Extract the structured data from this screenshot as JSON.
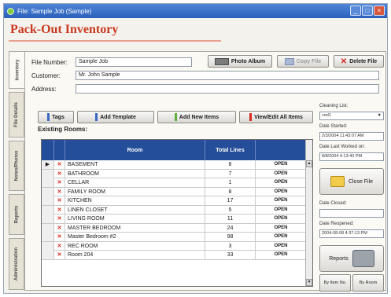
{
  "window": {
    "title": "File: Sample Job (Sample)",
    "minimize": "_",
    "maximize": "□",
    "close": "×"
  },
  "app": {
    "title": "Pack-Out Inventory"
  },
  "tabs": [
    "Inventory",
    "File Details",
    "Notes/Photos",
    "Reports",
    "Administration"
  ],
  "form": {
    "file_number_label": "File Number:",
    "file_number_value": "Sample Job",
    "customer_label": "Customer:",
    "customer_value": "Mr. John Sample",
    "address_label": "Address:",
    "address_value": ""
  },
  "top_buttons": {
    "photo_album": "Photo Album",
    "copy_file": "Copy File",
    "delete_file": "Delete File"
  },
  "toolbar": {
    "tags": "Tags",
    "add_template": "Add Template",
    "add_new_items": "Add New Items",
    "view_edit_all_items": "View/Edit All Items"
  },
  "existing_rooms_label": "Existing Rooms:",
  "table": {
    "columns": [
      "Room",
      "Total Lines"
    ],
    "rows": [
      {
        "room": "BASEMENT",
        "lines": "8",
        "action": "OPEN",
        "selected": true
      },
      {
        "room": "BATHROOM",
        "lines": "7",
        "action": "OPEN"
      },
      {
        "room": "CELLAR",
        "lines": "1",
        "action": "OPEN"
      },
      {
        "room": "FAMILY ROOM",
        "lines": "8",
        "action": "OPEN"
      },
      {
        "room": "KITCHEN",
        "lines": "17",
        "action": "OPEN"
      },
      {
        "room": "LINEN CLOSET",
        "lines": "5",
        "action": "OPEN"
      },
      {
        "room": "LIVING ROOM",
        "lines": "11",
        "action": "OPEN"
      },
      {
        "room": "MASTER BEDROOM",
        "lines": "24",
        "action": "OPEN"
      },
      {
        "room": "Master Bedroom #2",
        "lines": "98",
        "action": "OPEN"
      },
      {
        "room": "REC ROOM",
        "lines": "3",
        "action": "OPEN"
      },
      {
        "room": "Room 204",
        "lines": "33",
        "action": "OPEN"
      }
    ]
  },
  "right_panel": {
    "cleaning_list_label": "Cleaning List:",
    "cleaning_list_value": "ced1",
    "date_started_label": "Date Started:",
    "date_started_value": "2/3/2004 11:43:07 AM",
    "date_last_worked_label": "Date Last Worked on:",
    "date_last_worked_value": "8/8/2004 4:13:40 PM",
    "close_file": "Close File",
    "date_closed_label": "Date Closed:",
    "date_closed_value": "",
    "date_reopened_label": "Date Reopened:",
    "date_reopened_value": "2004-08-08 4:37:13 PM",
    "reports": "Reports",
    "by_item_no": "By Item No.",
    "by_room": "By Room"
  },
  "colors": {
    "accent": "#c8391f",
    "header": "#244d9a",
    "delete": "#d4281e"
  }
}
